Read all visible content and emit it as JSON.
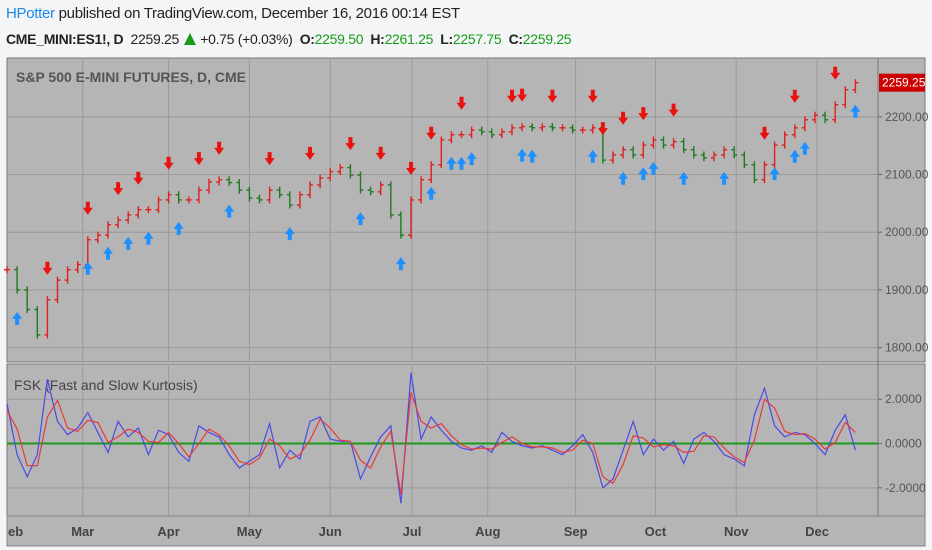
{
  "header": {
    "user": "HPotter",
    "published": "published on TradingView.com, December 16, 2016 00:14 EST",
    "symbol": "CME_MINI:ES1!, D",
    "last": "2259.25",
    "change": "+0.75 (+0.03%)",
    "o_label": "O:",
    "o": "2259.50",
    "h_label": "H:",
    "h": "2261.25",
    "l_label": "L:",
    "l": "2257.75",
    "c_label": "C:",
    "c": "2259.25"
  },
  "colors": {
    "up": "#e0201e",
    "down": "#1f7a1f",
    "buy": "#1e90ff",
    "sell": "#e8120f",
    "fast": "#4a4ae8",
    "slow": "#e83a3a",
    "zero": "#1b9a1b",
    "pane": "#b5b5b5"
  },
  "chart_data": [
    {
      "type": "line",
      "title": "S&P 500 E-MINI FUTURES, D, CME",
      "ylim": [
        1775,
        2302
      ],
      "y_ticks": [
        "2200.00",
        "2100.00",
        "2000.00",
        "1900.00",
        "1800.00"
      ],
      "y_tick_values": [
        2200,
        2100,
        2000,
        1900,
        1800
      ],
      "last_price_label": "2259.25",
      "last_price": 2259.25,
      "x_ticks": [
        {
          "label": "eb",
          "index": 0
        },
        {
          "label": "Mar",
          "index": 7.5
        },
        {
          "label": "Apr",
          "index": 16
        },
        {
          "label": "May",
          "index": 24
        },
        {
          "label": "Jun",
          "index": 32
        },
        {
          "label": "Jul",
          "index": 40.1
        },
        {
          "label": "Aug",
          "index": 47.6
        },
        {
          "label": "Sep",
          "index": 56.3
        },
        {
          "label": "Oct",
          "index": 64.2
        },
        {
          "label": "Nov",
          "index": 72.2
        },
        {
          "label": "Dec",
          "index": 80.2
        }
      ],
      "close": [
        1935,
        1900,
        1866,
        1822,
        1883,
        1917,
        1935,
        1944,
        1987,
        1995,
        2013,
        2021,
        2030,
        2039,
        2039,
        2056,
        2065,
        2056,
        2056,
        2073,
        2087,
        2091,
        2086,
        2073,
        2059,
        2056,
        2073,
        2065,
        2047,
        2065,
        2082,
        2094,
        2105,
        2112,
        2099,
        2073,
        2070,
        2082,
        2030,
        1995,
        2056,
        2091,
        2117,
        2160,
        2169,
        2169,
        2177,
        2174,
        2169,
        2174,
        2181,
        2183,
        2181,
        2183,
        2181,
        2181,
        2177,
        2177,
        2181,
        2125,
        2134,
        2143,
        2134,
        2151,
        2160,
        2151,
        2157,
        2143,
        2134,
        2129,
        2134,
        2143,
        2134,
        2117,
        2091,
        2117,
        2151,
        2169,
        2181,
        2195,
        2203,
        2195,
        2221,
        2247,
        2259.25
      ],
      "sell_signals": [
        4,
        8,
        11,
        13,
        16,
        19,
        21,
        26,
        30,
        34,
        37,
        40,
        42,
        45,
        50,
        51,
        54,
        58,
        59,
        61,
        63,
        66,
        75,
        78,
        82
      ],
      "buy_signals": [
        1,
        8,
        10,
        12,
        14,
        17,
        22,
        28,
        35,
        39,
        42,
        44,
        45,
        46,
        51,
        52,
        58,
        61,
        63,
        64,
        67,
        71,
        76,
        78,
        79,
        84
      ]
    },
    {
      "type": "line",
      "title": "FSK (Fast and Slow Kurtosis)",
      "ylim": [
        -3.27,
        3.59
      ],
      "y_ticks": [
        "2.0000",
        "0.0000",
        "-2.0000"
      ],
      "y_tick_values": [
        2,
        0,
        -2
      ],
      "series": [
        {
          "name": "Fast",
          "values": [
            1.8,
            -0.5,
            -1.5,
            -0.5,
            2.9,
            1.0,
            0.4,
            0.7,
            1.4,
            0.5,
            -0.4,
            1.0,
            0.3,
            0.7,
            -0.5,
            0.6,
            0.4,
            -0.4,
            -0.8,
            0.8,
            0.5,
            0.3,
            -0.5,
            -1.1,
            -0.8,
            -0.5,
            0.9,
            -1.1,
            -0.3,
            -0.7,
            1.0,
            1.2,
            0.2,
            0.1,
            0.1,
            -1.6,
            -0.6,
            0.3,
            0.8,
            -2.7,
            3.2,
            0.2,
            1.2,
            0.6,
            0.1,
            -0.2,
            -0.3,
            -0.1,
            -0.4,
            0.5,
            0.1,
            -0.1,
            -0.2,
            -0.1,
            -0.3,
            -0.5,
            -0.1,
            0.4,
            -0.4,
            -2.0,
            -1.6,
            -0.3,
            1.0,
            -0.5,
            0.2,
            -0.3,
            0.1,
            -0.9,
            0.2,
            0.5,
            0.1,
            -0.5,
            -0.7,
            -1.0,
            1.3,
            2.5,
            0.8,
            0.3,
            0.5,
            0.4,
            0.0,
            -0.5,
            0.6,
            1.3,
            -0.3
          ]
        },
        {
          "name": "Slow",
          "values": [
            1.5,
            0.65,
            -1.0,
            -1.0,
            1.2,
            1.95,
            0.7,
            0.55,
            1.05,
            0.95,
            0.05,
            0.3,
            0.65,
            0.5,
            0.1,
            0.05,
            0.5,
            0.0,
            -0.6,
            0.0,
            0.65,
            0.4,
            -0.1,
            -0.8,
            -0.95,
            -0.65,
            0.2,
            -0.1,
            -0.7,
            -0.5,
            0.15,
            1.1,
            0.7,
            0.15,
            0.1,
            -0.75,
            -1.1,
            -0.15,
            0.55,
            -2.3,
            2.3,
            1.0,
            0.7,
            0.9,
            0.35,
            -0.05,
            -0.25,
            -0.2,
            -0.25,
            0.05,
            0.3,
            0.0,
            -0.15,
            -0.15,
            -0.2,
            -0.4,
            -0.3,
            0.15,
            0.0,
            -1.5,
            -1.8,
            -0.95,
            0.35,
            0.25,
            -0.15,
            -0.05,
            -0.1,
            -0.4,
            -0.35,
            0.35,
            0.3,
            -0.2,
            -0.6,
            -0.85,
            0.15,
            2.0,
            1.6,
            0.55,
            0.4,
            0.45,
            0.2,
            -0.25,
            0.05,
            0.95,
            0.5
          ]
        }
      ],
      "zero_line": 0
    }
  ]
}
